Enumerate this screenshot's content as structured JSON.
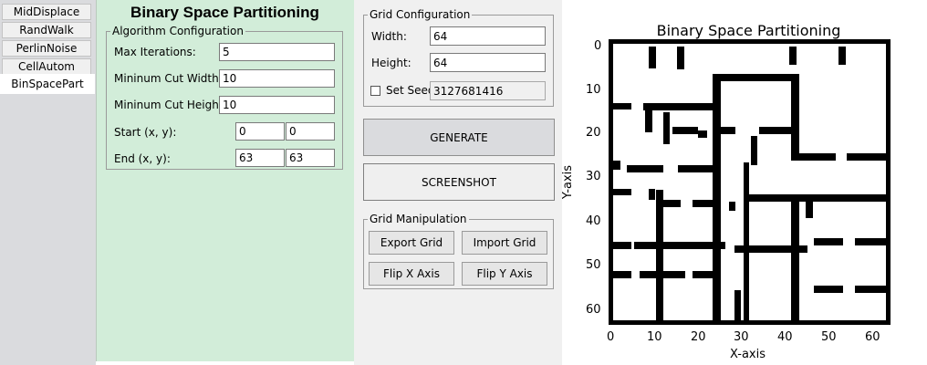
{
  "sidebar": {
    "tabs": [
      {
        "label": "MidDisplace"
      },
      {
        "label": "RandWalk"
      },
      {
        "label": "PerlinNoise"
      },
      {
        "label": "CellAutom"
      },
      {
        "label": "BinSpacePart"
      }
    ],
    "selected": "BinSpacePart"
  },
  "panel": {
    "title": "Binary Space Partitioning",
    "algo_group": "Algorithm Configuration",
    "max_iter_label": "Max Iterations:",
    "max_iter_value": "5",
    "min_cut_w_label": "Mininum Cut Width:",
    "min_cut_w_value": "10",
    "min_cut_h_label": "Mininum Cut Height:",
    "min_cut_h_value": "10",
    "start_label": "Start (x, y):",
    "start_x": "0",
    "start_y": "0",
    "end_label": "End (x, y):",
    "end_x": "63",
    "end_y": "63"
  },
  "grid_config": {
    "group": "Grid Configuration",
    "width_label": "Width:",
    "width_value": "64",
    "height_label": "Height:",
    "height_value": "64",
    "seed_label": "Set Seed",
    "seed_checked": false,
    "seed_value": "3127681416"
  },
  "actions": {
    "generate": "GENERATE",
    "screenshot": "SCREENSHOT"
  },
  "manipulation": {
    "group": "Grid Manipulation",
    "export": "Export Grid",
    "import": "Import Grid",
    "flip_x": "Flip X Axis",
    "flip_y": "Flip Y Axis"
  },
  "plot": {
    "title": "Binary Space Partitioning",
    "xlabel": "X-axis",
    "ylabel": "Y-axis",
    "xticks": [
      "0",
      "10",
      "20",
      "30",
      "40",
      "50",
      "60"
    ],
    "yticks": [
      "0",
      "10",
      "20",
      "30",
      "40",
      "50",
      "60"
    ],
    "grid_size": 64,
    "colors": {
      "wall": "#000000",
      "floor": "#ffffff"
    }
  }
}
